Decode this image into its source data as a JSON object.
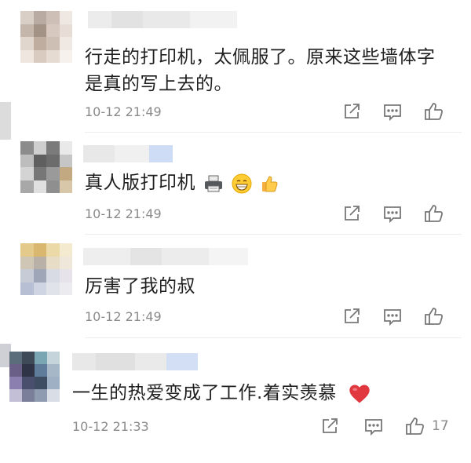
{
  "comments": [
    {
      "text_lines": [
        "行走的打印机，太佩服了。原来这些墙体字",
        "是真的写上去的。"
      ],
      "time": "10-12 21:49",
      "likes": ""
    },
    {
      "text_lines": [
        "真人版打印机"
      ],
      "emoji_icons": [
        "printer-icon",
        "grinning-face-icon",
        "thumbs-up-icon"
      ],
      "time": "10-12 21:49",
      "likes": ""
    },
    {
      "text_lines": [
        "厉害了我的叔"
      ],
      "time": "10-12 21:49",
      "likes": ""
    },
    {
      "text_lines": [
        "一生的热爱变成了工作.着实羡慕"
      ],
      "emoji_icons": [
        "red-heart-icon"
      ],
      "time": "10-12 21:33",
      "likes": "17"
    }
  ],
  "action_icons": [
    "share-icon",
    "reply-icon",
    "like-icon"
  ],
  "colors": {
    "text": "#1f1f1f",
    "meta": "#8a8a8a",
    "heart": "#e0383e",
    "divider": "#ececec"
  }
}
